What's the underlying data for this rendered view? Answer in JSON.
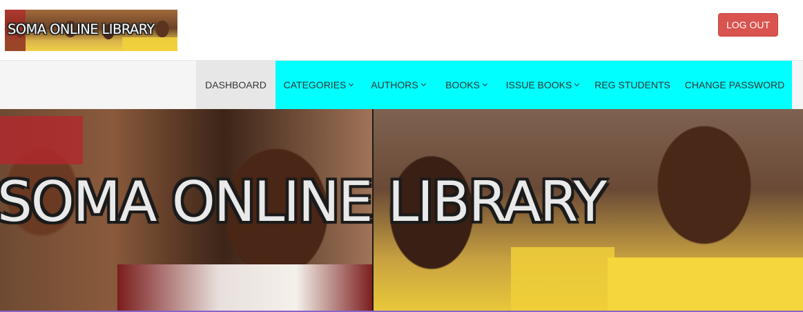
{
  "header": {
    "logo_text": "SOMA ONLINE LIBRARY",
    "logout_label": "LOG OUT"
  },
  "nav": {
    "items": [
      {
        "label": "DASHBOARD",
        "dropdown": false,
        "active": true
      },
      {
        "label": "CATEGORIES",
        "dropdown": true
      },
      {
        "label": "AUTHORS",
        "dropdown": true
      },
      {
        "label": "BOOKS",
        "dropdown": true
      },
      {
        "label": "ISSUE BOOKS",
        "dropdown": true
      },
      {
        "label": "REG STUDENTS",
        "dropdown": false
      },
      {
        "label": "CHANGE PASSWORD",
        "dropdown": false
      }
    ]
  },
  "banner": {
    "title": "SOMA ONLINE LIBRARY"
  },
  "colors": {
    "logout_button": "#d9534f",
    "nav_highlight": "#00ffff",
    "active_item": "#e7e7e7",
    "navbar_bg": "#f5f5f5"
  }
}
